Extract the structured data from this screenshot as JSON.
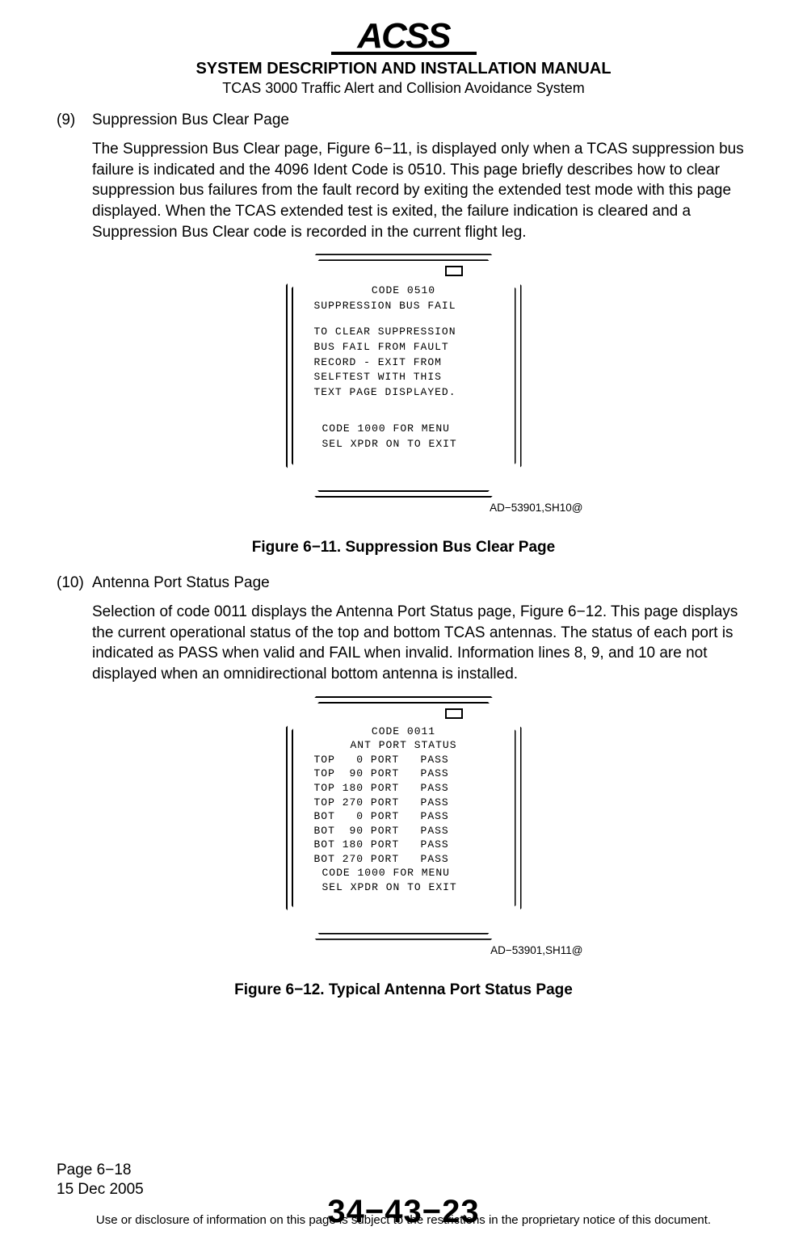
{
  "header": {
    "logo_text": "ACSS",
    "title": "SYSTEM DESCRIPTION AND INSTALLATION MANUAL",
    "subtitle": "TCAS 3000 Traffic Alert and Collision Avoidance System"
  },
  "section9": {
    "num": "(9)",
    "title": "Suppression Bus Clear Page",
    "body": "The Suppression Bus Clear page, Figure 6−11, is displayed only when a TCAS suppression bus failure is indicated and the 4096 Ident Code is 0510.  This page briefly describes how to clear suppression bus failures from the fault record by exiting the extended test mode with this page displayed.  When the TCAS extended test is exited, the failure indication is cleared and a Suppression Bus Clear code is recorded in the current flight leg."
  },
  "figure11": {
    "lines": {
      "l1": "CODE 0510",
      "l2": "SUPPRESSION BUS FAIL",
      "l3": "TO CLEAR SUPPRESSION",
      "l4": "BUS FAIL FROM FAULT",
      "l5": "RECORD - EXIT FROM",
      "l6": "SELFTEST WITH THIS",
      "l7": "TEXT PAGE DISPLAYED.",
      "l8": "CODE 1000 FOR MENU",
      "l9": "SEL XPDR ON TO EXIT"
    },
    "ref": "AD−53901,SH10@",
    "caption": "Figure 6−11.  Suppression Bus Clear Page"
  },
  "section10": {
    "num": "(10)",
    "title": "Antenna Port Status Page",
    "body": "Selection of code 0011 displays the Antenna Port Status page, Figure 6−12.  This page displays the current operational status of the top and bottom TCAS antennas. The status of each port is indicated as PASS when valid and FAIL when invalid. Information lines 8, 9, and 10 are not displayed when an omnidirectional bottom antenna is installed."
  },
  "figure12": {
    "lines": {
      "l1": "CODE 0011",
      "l2": "ANT PORT STATUS",
      "l3": "TOP   0 PORT   PASS",
      "l4": "TOP  90 PORT   PASS",
      "l5": "TOP 180 PORT   PASS",
      "l6": "TOP 270 PORT   PASS",
      "l7": "BOT   0 PORT   PASS",
      "l8": "BOT  90 PORT   PASS",
      "l9": "BOT 180 PORT   PASS",
      "l10": "BOT 270 PORT   PASS",
      "l11": "CODE 1000 FOR MENU",
      "l12": "SEL XPDR ON TO EXIT"
    },
    "ref": "AD−53901,SH11@",
    "caption": "Figure 6−12.  Typical Antenna Port Status Page"
  },
  "footer": {
    "page": "Page 6−18",
    "date": "15 Dec 2005",
    "docnum": "34−43−23",
    "disclaimer": "Use or disclosure of information on this page is subject to the restrictions in the proprietary notice of this document."
  }
}
